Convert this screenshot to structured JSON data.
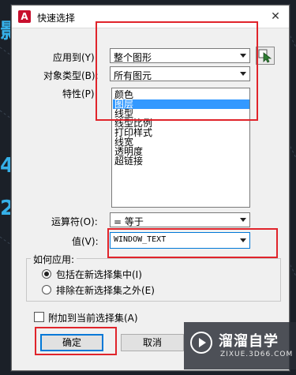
{
  "window": {
    "title": "快速选择",
    "app_icon_letter": "A"
  },
  "apply_to": {
    "label": "应用到(Y):",
    "value": "整个图形"
  },
  "object_type": {
    "label": "对象类型(B):",
    "value": "所有图元"
  },
  "properties": {
    "label": "特性(P):",
    "items": [
      "颜色",
      "图层",
      "线型",
      "线型比例",
      "打印样式",
      "线宽",
      "透明度",
      "超链接"
    ],
    "selected_index": 1
  },
  "operator": {
    "label": "运算符(O):",
    "value": "= 等于"
  },
  "value": {
    "label": "值(V):",
    "value": "WINDOW_TEXT"
  },
  "how_to_apply": {
    "title": "如何应用:",
    "include_label": "包括在新选择集中(I)",
    "exclude_label": "排除在新选择集之外(E)",
    "selected": "include"
  },
  "append": {
    "label": "附加到当前选择集(A)",
    "checked": false
  },
  "buttons": {
    "ok": "确定",
    "cancel": "取消"
  },
  "background_glyphs": {
    "top_left": "影",
    "mid1": "4",
    "mid2": "2"
  },
  "watermark": {
    "name": "溜溜自学",
    "url": "ZIXUE.3D66.COM"
  },
  "colors": {
    "highlight": "#e0242b",
    "selection": "#3399ff"
  }
}
